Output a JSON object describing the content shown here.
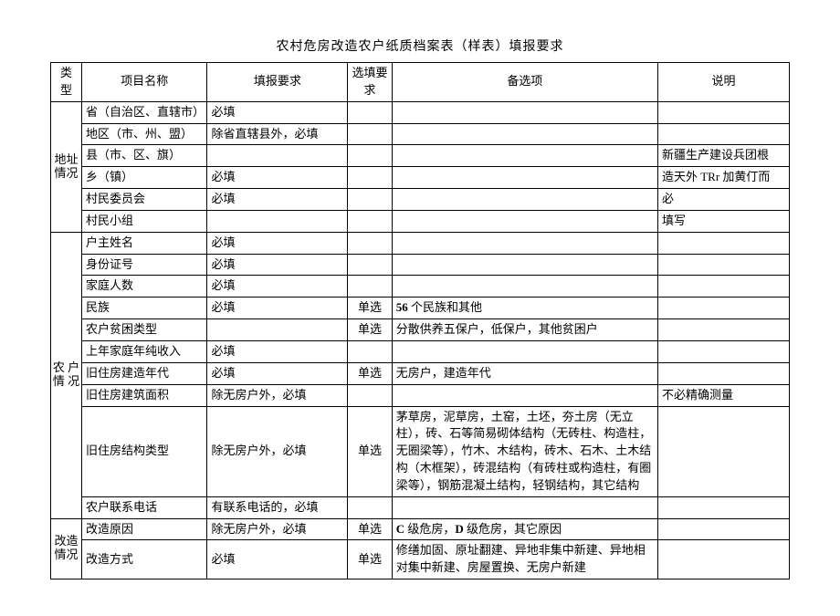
{
  "title": "农村危房改造农户纸质档案表（样表）填报要求",
  "head": {
    "type": "类型",
    "name": "项目名称",
    "req": "填报要求",
    "sel": "选填要求",
    "opt": "备选项",
    "note": "说明"
  },
  "sections": {
    "addr": {
      "label": "地址情况",
      "rows": [
        {
          "name": "省（自治区、直辖市）",
          "req": "必填",
          "sel": "",
          "opt": "",
          "note": ""
        },
        {
          "name": "地区（市、州、盟）",
          "req": "除省直辖县外，必填",
          "sel": "",
          "opt": "",
          "note": ""
        },
        {
          "name": "县（市、区、旗）",
          "req": "",
          "sel": "",
          "opt": "",
          "note": "新疆生产建设兵团根"
        },
        {
          "name": "乡（镇）",
          "req": "必填",
          "sel": "",
          "opt": "",
          "note": "造天外 TRr 加黄仃而"
        },
        {
          "name": "村民委员会",
          "req": "必填",
          "sel": "",
          "opt": "",
          "note": "必"
        },
        {
          "name": "村民小组",
          "req": "",
          "sel": "",
          "opt": "",
          "note": "填写"
        }
      ]
    },
    "house": {
      "label": "农 户情 况",
      "rows": [
        {
          "name": "户主姓名",
          "req": "必填",
          "sel": "",
          "opt": "",
          "note": ""
        },
        {
          "name": "身份证号",
          "req": "必填",
          "sel": "",
          "opt": "",
          "note": ""
        },
        {
          "name": "家庭人数",
          "req": "必填",
          "sel": "",
          "opt": "",
          "note": ""
        },
        {
          "name": "民族",
          "req": "必填",
          "sel": "单选",
          "opt_pre": "56",
          "opt_post": " 个民族和其他",
          "note": ""
        },
        {
          "name": "农户贫困类型",
          "req": "",
          "sel": "单选",
          "opt": "分散供养五保户，低保户，其他贫困户",
          "note": ""
        },
        {
          "name": "上年家庭年纯收入",
          "req": "必填",
          "sel": "",
          "opt": "",
          "note": ""
        },
        {
          "name": "旧住房建造年代",
          "req": "必填",
          "sel": "单选",
          "opt": "无房户，建造年代",
          "note": ""
        },
        {
          "name": "旧住房建筑面积",
          "req": "除无房户外，必填",
          "sel": "",
          "opt": "",
          "note": "不必精确测量"
        },
        {
          "name": "旧住房结构类型",
          "req": "除无房户外，必填",
          "sel": "单选",
          "opt": "茅草房，泥草房，土窑，土坯，夯土房（无立柱），砖、石等简易砌体结构（无砖柱、构造柱，无圈梁等），竹木、木结构，砖木、石木、土木结构（木框架），砖混结构（有砖柱或构造柱，有圈梁等），钢筋混凝土结构，轻钢结构，其它结构",
          "note": ""
        },
        {
          "name": "农户联系电话",
          "req": "有联系电话的，必填",
          "sel": "",
          "opt": "",
          "note": ""
        }
      ]
    },
    "reno": {
      "label": "改造情况",
      "rows": [
        {
          "name": "改造原因",
          "req": "除无房户外，必填",
          "sel": "单选",
          "opt_pre": "C",
          "opt_mid": " 级危房，",
          "opt_pre2": "D",
          "opt_post": " 级危房，其它原因",
          "note": ""
        },
        {
          "name": "改造方式",
          "req": "必填",
          "sel": "单选",
          "opt": "修缮加固、原址翻建、异地非集中新建、异地相对集中新建、房屋置换、无房户新建",
          "note": ""
        }
      ]
    }
  }
}
